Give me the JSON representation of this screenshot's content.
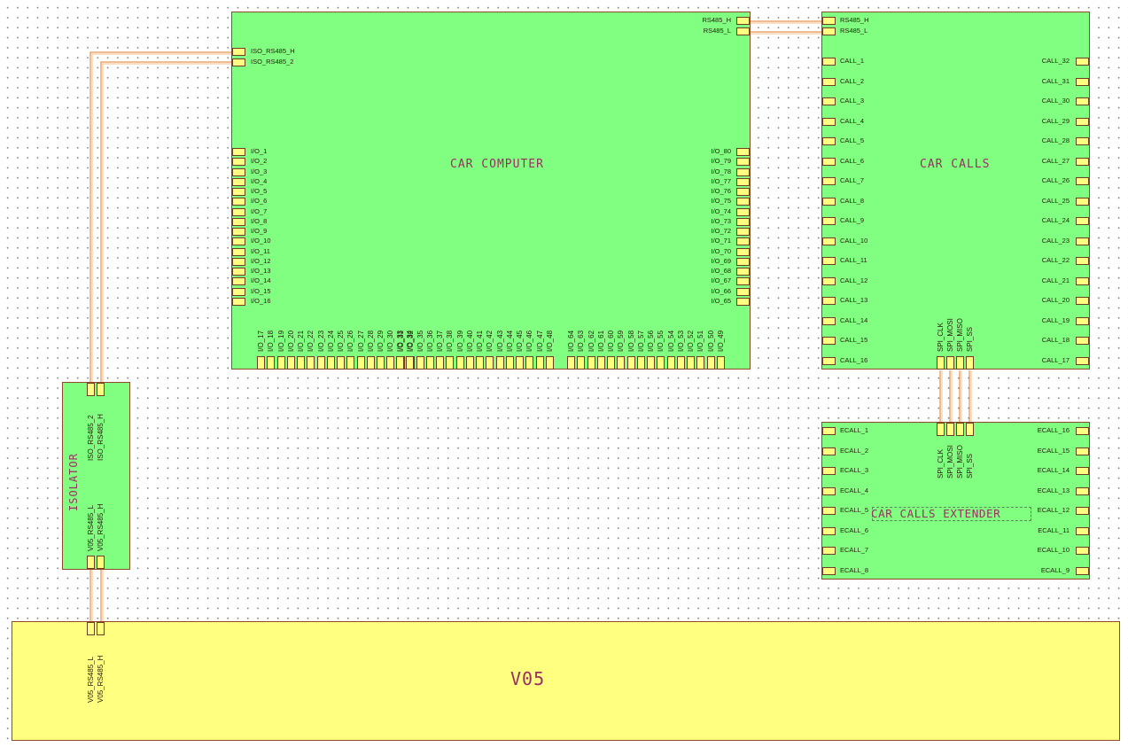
{
  "colors": {
    "block_fill": "#80ff80",
    "host_fill": "#ffff80",
    "pin_fill": "#ffff80",
    "wire": "#e07a2a",
    "title": "#9a2f63"
  },
  "blocks": {
    "car_computer": {
      "title": "CAR COMPUTER",
      "comm_pins": [
        "RS485_H",
        "RS485_L"
      ],
      "iso_pins": [
        "ISO_RS485_H",
        "ISO_RS485_2"
      ],
      "left_pins": [
        "I/O_1",
        "I/O_2",
        "I/O_3",
        "I/O_4",
        "I/O_5",
        "I/O_6",
        "I/O_7",
        "I/O_8",
        "I/O_9",
        "I/O_10",
        "I/O_11",
        "I/O_12",
        "I/O_13",
        "I/O_14",
        "I/O_15",
        "I/O_16"
      ],
      "right_pins": [
        "I/O_80",
        "I/O_79",
        "I/O_78",
        "I/O_77",
        "I/O_76",
        "I/O_75",
        "I/O_74",
        "I/O_73",
        "I/O_72",
        "I/O_71",
        "I/O_70",
        "I/O_69",
        "I/O_68",
        "I/O_67",
        "I/O_66",
        "I/O_65"
      ],
      "bottom_pins_a": [
        "I/O_17",
        "I/O_18",
        "I/O_19",
        "I/O_20",
        "I/O_21",
        "I/O_22",
        "I/O_23",
        "I/O_24",
        "I/O_25",
        "I/O_26",
        "I/O_27",
        "I/O_28",
        "I/O_29",
        "I/O_30",
        "I/O_31",
        "I/O_32"
      ],
      "bottom_pins_b": [
        "I/O_33",
        "I/O_34",
        "I/O_35",
        "I/O_36",
        "I/O_37",
        "I/O_38",
        "I/O_39",
        "I/O_40",
        "I/O_41",
        "I/O_42",
        "I/O_43",
        "I/O_44",
        "I/O_45",
        "I/O_46",
        "I/O_47",
        "I/O_48"
      ],
      "bottom_pins_c": [
        "I/O_64",
        "I/O_63",
        "I/O_62",
        "I/O_61",
        "I/O_60",
        "I/O_59",
        "I/O_58",
        "I/O_57",
        "I/O_56",
        "I/O_55",
        "I/O_54",
        "I/O_53",
        "I/O_52",
        "I/O_51",
        "I/O_50",
        "I/O_49"
      ]
    },
    "car_calls": {
      "title": "CAR CALLS",
      "comm_pins": [
        "RS485_H",
        "RS485_L"
      ],
      "left_pins": [
        "CALL_1",
        "CALL_2",
        "CALL_3",
        "CALL_4",
        "CALL_5",
        "CALL_6",
        "CALL_7",
        "CALL_8",
        "CALL_9",
        "CALL_10",
        "CALL_11",
        "CALL_12",
        "CALL_13",
        "CALL_14",
        "CALL_15",
        "CALL_16"
      ],
      "right_pins": [
        "CALL_32",
        "CALL_31",
        "CALL_30",
        "CALL_29",
        "CALL_28",
        "CALL_27",
        "CALL_26",
        "CALL_25",
        "CALL_24",
        "CALL_23",
        "CALL_22",
        "CALL_21",
        "CALL_20",
        "CALL_19",
        "CALL_18",
        "CALL_17"
      ],
      "spi_pins": [
        "SPI_CLK",
        "SPI_MOSI",
        "SPI_MISO",
        "SPI_SS"
      ]
    },
    "extender": {
      "title": "CAR CALLS EXTENDER",
      "left_pins": [
        "ECALL_1",
        "ECALL_2",
        "ECALL_3",
        "ECALL_4",
        "ECALL_5",
        "ECALL_6",
        "ECALL_7",
        "ECALL_8"
      ],
      "right_pins": [
        "ECALL_16",
        "ECALL_15",
        "ECALL_14",
        "ECALL_13",
        "ECALL_12",
        "ECALL_11",
        "ECALL_10",
        "ECALL_9"
      ],
      "spi_pins": [
        "SPI_CLK",
        "SPI_MOSI",
        "SPI_MISO",
        "SPI_SS"
      ]
    },
    "isolator": {
      "title": "ISOLATOR",
      "top_pins": [
        "ISO_RS485_2",
        "ISO_RS485_H"
      ],
      "bottom_pins": [
        "V05_RS485_L",
        "V05_RS485_H"
      ]
    },
    "v05": {
      "title": "V05",
      "top_pins": [
        "V05_RS485_L",
        "V05_RS485_H"
      ]
    }
  }
}
